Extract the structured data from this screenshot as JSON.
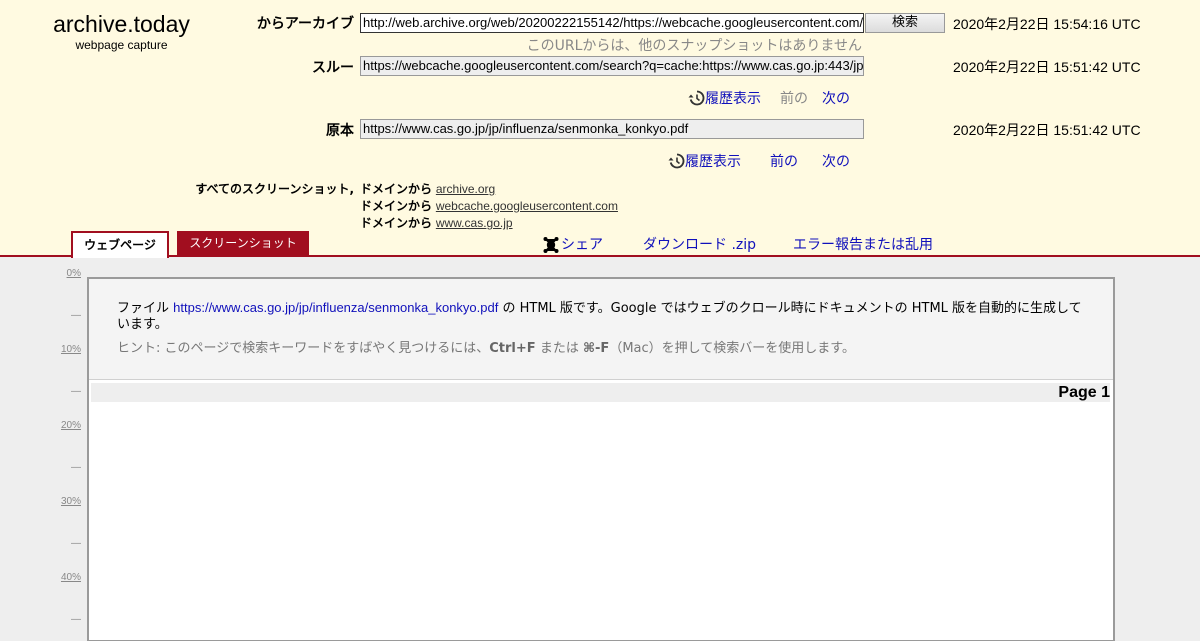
{
  "brand": {
    "title": "archive.today",
    "subtitle": "webpage capture"
  },
  "rows": {
    "archived": {
      "label": "からアーカイブ",
      "url": "http://web.archive.org/web/20200222155142/https://webcache.googleusercontent.com/",
      "timestamp": "2020年2月22日 15:54:16 UTC",
      "search_label": "検索",
      "note": "このURLからは、他のスナップショットはありません"
    },
    "via": {
      "label": "スルー",
      "url": "https://webcache.googleusercontent.com/search?q=cache:https://www.cas.go.jp:443/jp",
      "timestamp": "2020年2月22日 15:51:42 UTC",
      "history": "履歴表示",
      "prev": "前の",
      "next": "次の"
    },
    "original": {
      "label": "原本",
      "url": "https://www.cas.go.jp/jp/influenza/senmonka_konkyo.pdf",
      "timestamp": "2020年2月22日 15:51:42 UTC",
      "history": "履歴表示",
      "prev": "前の",
      "next": "次の"
    }
  },
  "domains": {
    "label": "すべてのスクリーンショット,",
    "items": [
      {
        "prefix": "ドメインから",
        "domain": "archive.org"
      },
      {
        "prefix": "ドメインから",
        "domain": "webcache.googleusercontent.com"
      },
      {
        "prefix": "ドメインから",
        "domain": "www.cas.go.jp"
      }
    ]
  },
  "tabs": {
    "webpage": "ウェブページ",
    "screenshot": "スクリーンショット"
  },
  "actions": {
    "share": "シェア",
    "download": "ダウンロード .zip",
    "report": "エラー報告または乱用"
  },
  "scale": {
    "p0": "0%",
    "p10": "10%",
    "p20": "20%",
    "p30": "30%",
    "p40": "40%",
    "dash": "—"
  },
  "content": {
    "info_prefix": "ファイル",
    "info_link": "https://www.cas.go.jp/jp/influenza/senmonka_konkyo.pdf",
    "info_suffix": "の HTML 版です。Google ではウェブのクロール時にドキュメントの HTML 版を自動的に生成しています。",
    "hint_prefix": "ヒント: このページで検索キーワードをすばやく見つけるには、",
    "hint_key1": "Ctrl+F",
    "hint_mid": "または",
    "hint_key2": "⌘-F",
    "hint_suffix": "（Mac）を押して検索バーを使用します。",
    "page_label": "Page 1"
  },
  "colors": {
    "header_bg": "#fffae1",
    "accent": "#a10e1f",
    "link": "#1010bb",
    "page_bg": "#eeeeee"
  }
}
